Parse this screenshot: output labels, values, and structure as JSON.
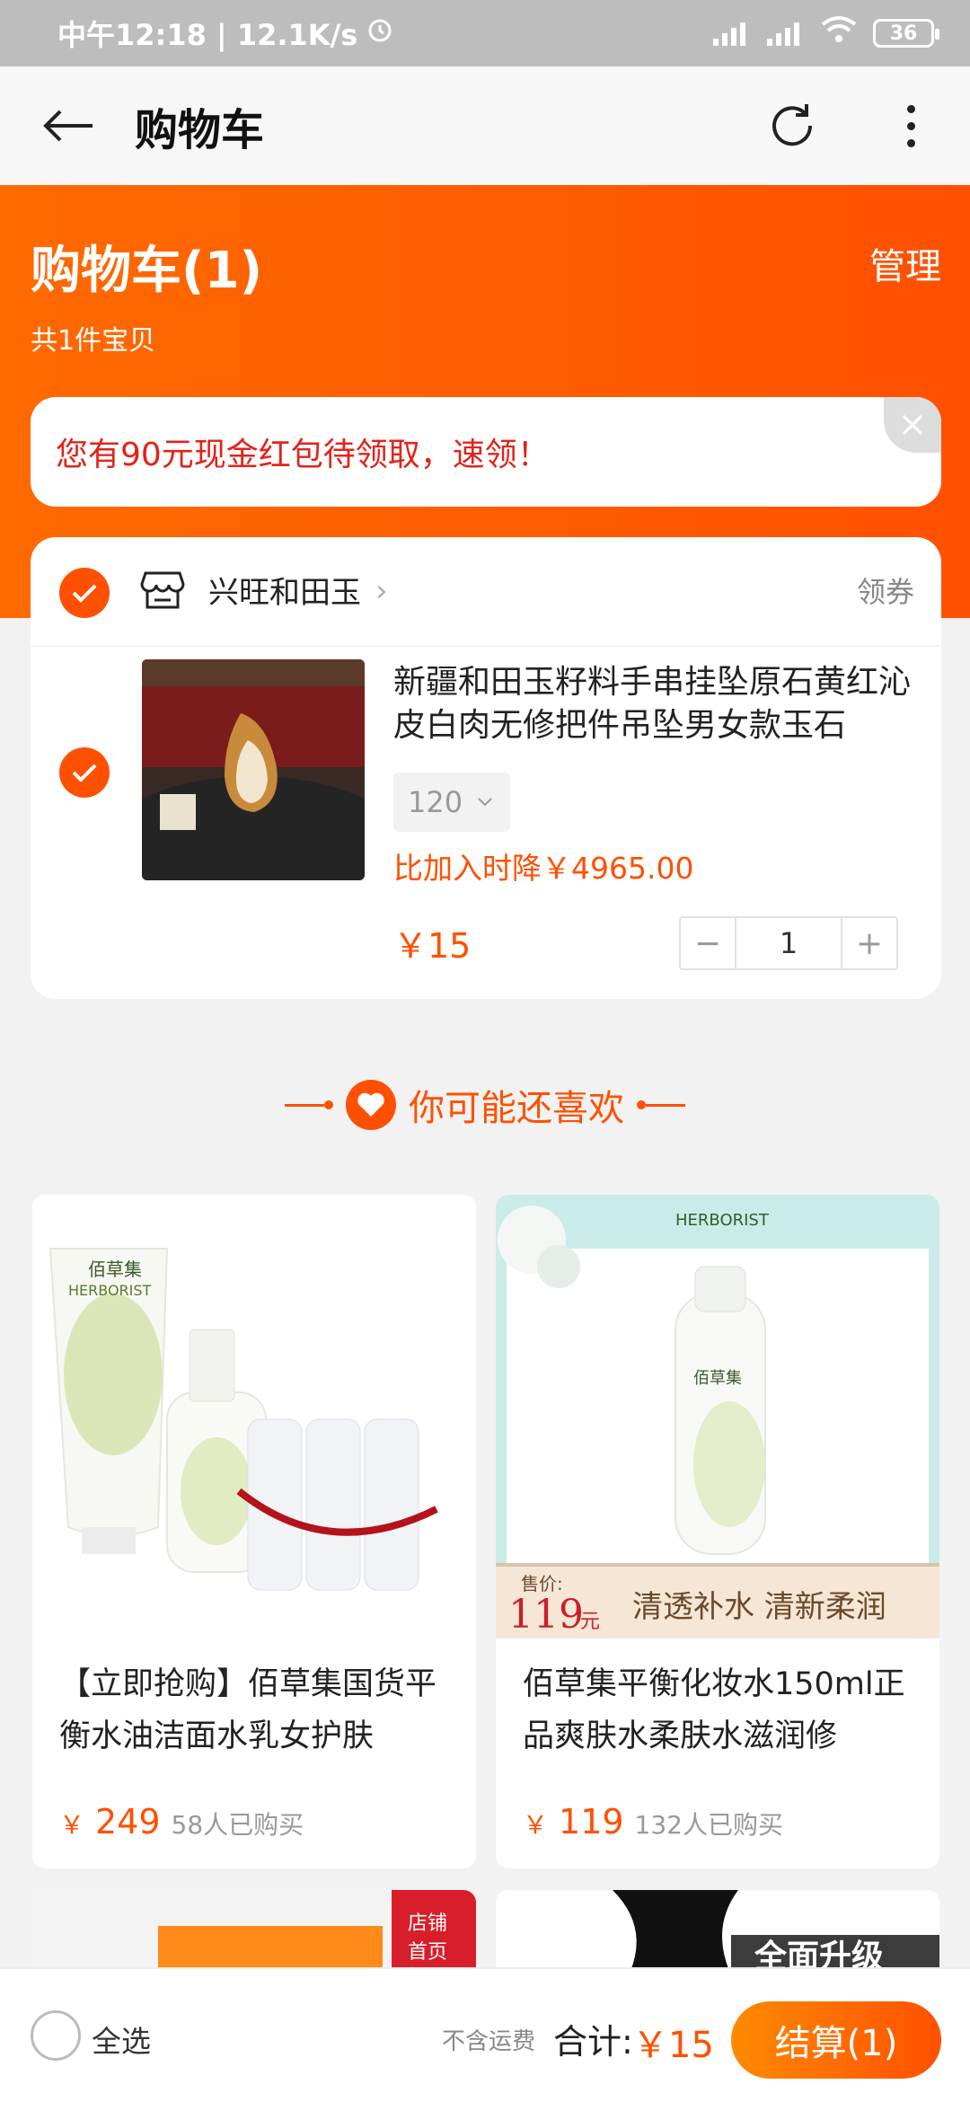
{
  "status_bar": {
    "time_speed": "中午12:18 | 12.1K/s",
    "battery": "36"
  },
  "nav": {
    "title": "购物车"
  },
  "header": {
    "cart_title": "购物车(1)",
    "manage_label": "管理",
    "item_count": "共1件宝贝"
  },
  "banner": {
    "text": "您有90元现金红包待领取，速领！"
  },
  "shop": {
    "name": "兴旺和田玉",
    "coupon_label": "领券"
  },
  "item": {
    "title": "新疆和田玉籽料手串挂坠原石黄红沁皮白肉无修把件吊坠男女款玉石",
    "sku": "120",
    "price_drop": "比加入时降￥4965.00",
    "price": "￥15",
    "quantity": "1",
    "minus": "−",
    "plus": "+"
  },
  "recommend": {
    "title": "你可能还喜欢"
  },
  "products": [
    {
      "title": "【立即抢购】佰草集国货平衡水油洁面水乳女护肤",
      "currency": "￥",
      "price": "249",
      "sold": "58人已购买",
      "brand_cn": "佰草集",
      "brand_en": "HERBORIST"
    },
    {
      "title": "佰草集平衡化妆水150ml正品爽肤水柔肤水滋润修",
      "currency": "￥",
      "price": "119",
      "sold": "132人已购买",
      "brand_cn": "佰草集",
      "brand_en": "HERBORIST",
      "promo_label": "售价:",
      "promo_price": "119",
      "promo_unit": "元",
      "promo_slogan": "清透补水 清新柔润"
    }
  ],
  "partial_cards": {
    "left_tag_line1": "店铺",
    "left_tag_line2": "首页",
    "right_tag": "全面升级"
  },
  "bottom_bar": {
    "select_all": "全选",
    "shipping_note": "不含运费",
    "total_label": "合计:",
    "total_value": "￥15",
    "checkout": "结算(1)"
  },
  "colors": {
    "accent": "#ff5000",
    "accent_light": "#ff6a00",
    "banner_text": "#e2231a"
  }
}
